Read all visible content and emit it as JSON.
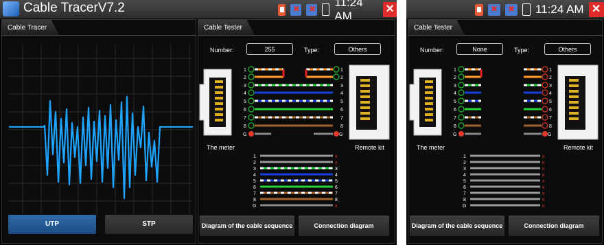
{
  "screen1": {
    "app_title": "Cable TracerV7.2",
    "time": "11:24 AM",
    "tracer_tab": "Cable Tracer",
    "tester_tab": "Cable Tester",
    "number_label": "Number:",
    "number_value": "255",
    "type_label": "Type:",
    "type_value": "Others",
    "meter_label": "The meter",
    "remote_label": "Remote kit",
    "utp_button": "UTP",
    "stp_button": "STP",
    "diagram_button": "Diagram of the cable sequence",
    "connection_button": "Connection diagram",
    "pin_labels": [
      "1",
      "2",
      "3",
      "4",
      "5",
      "6",
      "7",
      "8",
      "G"
    ]
  },
  "screen2": {
    "time": "11:24 AM",
    "tester_tab": "Cable Tester",
    "number_label": "Number:",
    "number_value": "None",
    "type_label": "Type:",
    "type_value": "Others",
    "meter_label": "The meter",
    "remote_label": "Remote kit",
    "diagram_button": "Diagram of the cable sequence",
    "connection_button": "Connection diagram",
    "pin_labels": [
      "1",
      "2",
      "3",
      "4",
      "5",
      "6",
      "7",
      "8",
      "G"
    ]
  },
  "colors": {
    "waveform": "#1ea3ff",
    "ok_check": "#22c034",
    "fail_mark": "#e0382b",
    "utp_active": "#2f6aa8"
  },
  "icons": [
    "app-icon",
    "sd-card-icon",
    "usb-icon",
    "battery-icon",
    "close-icon"
  ]
}
